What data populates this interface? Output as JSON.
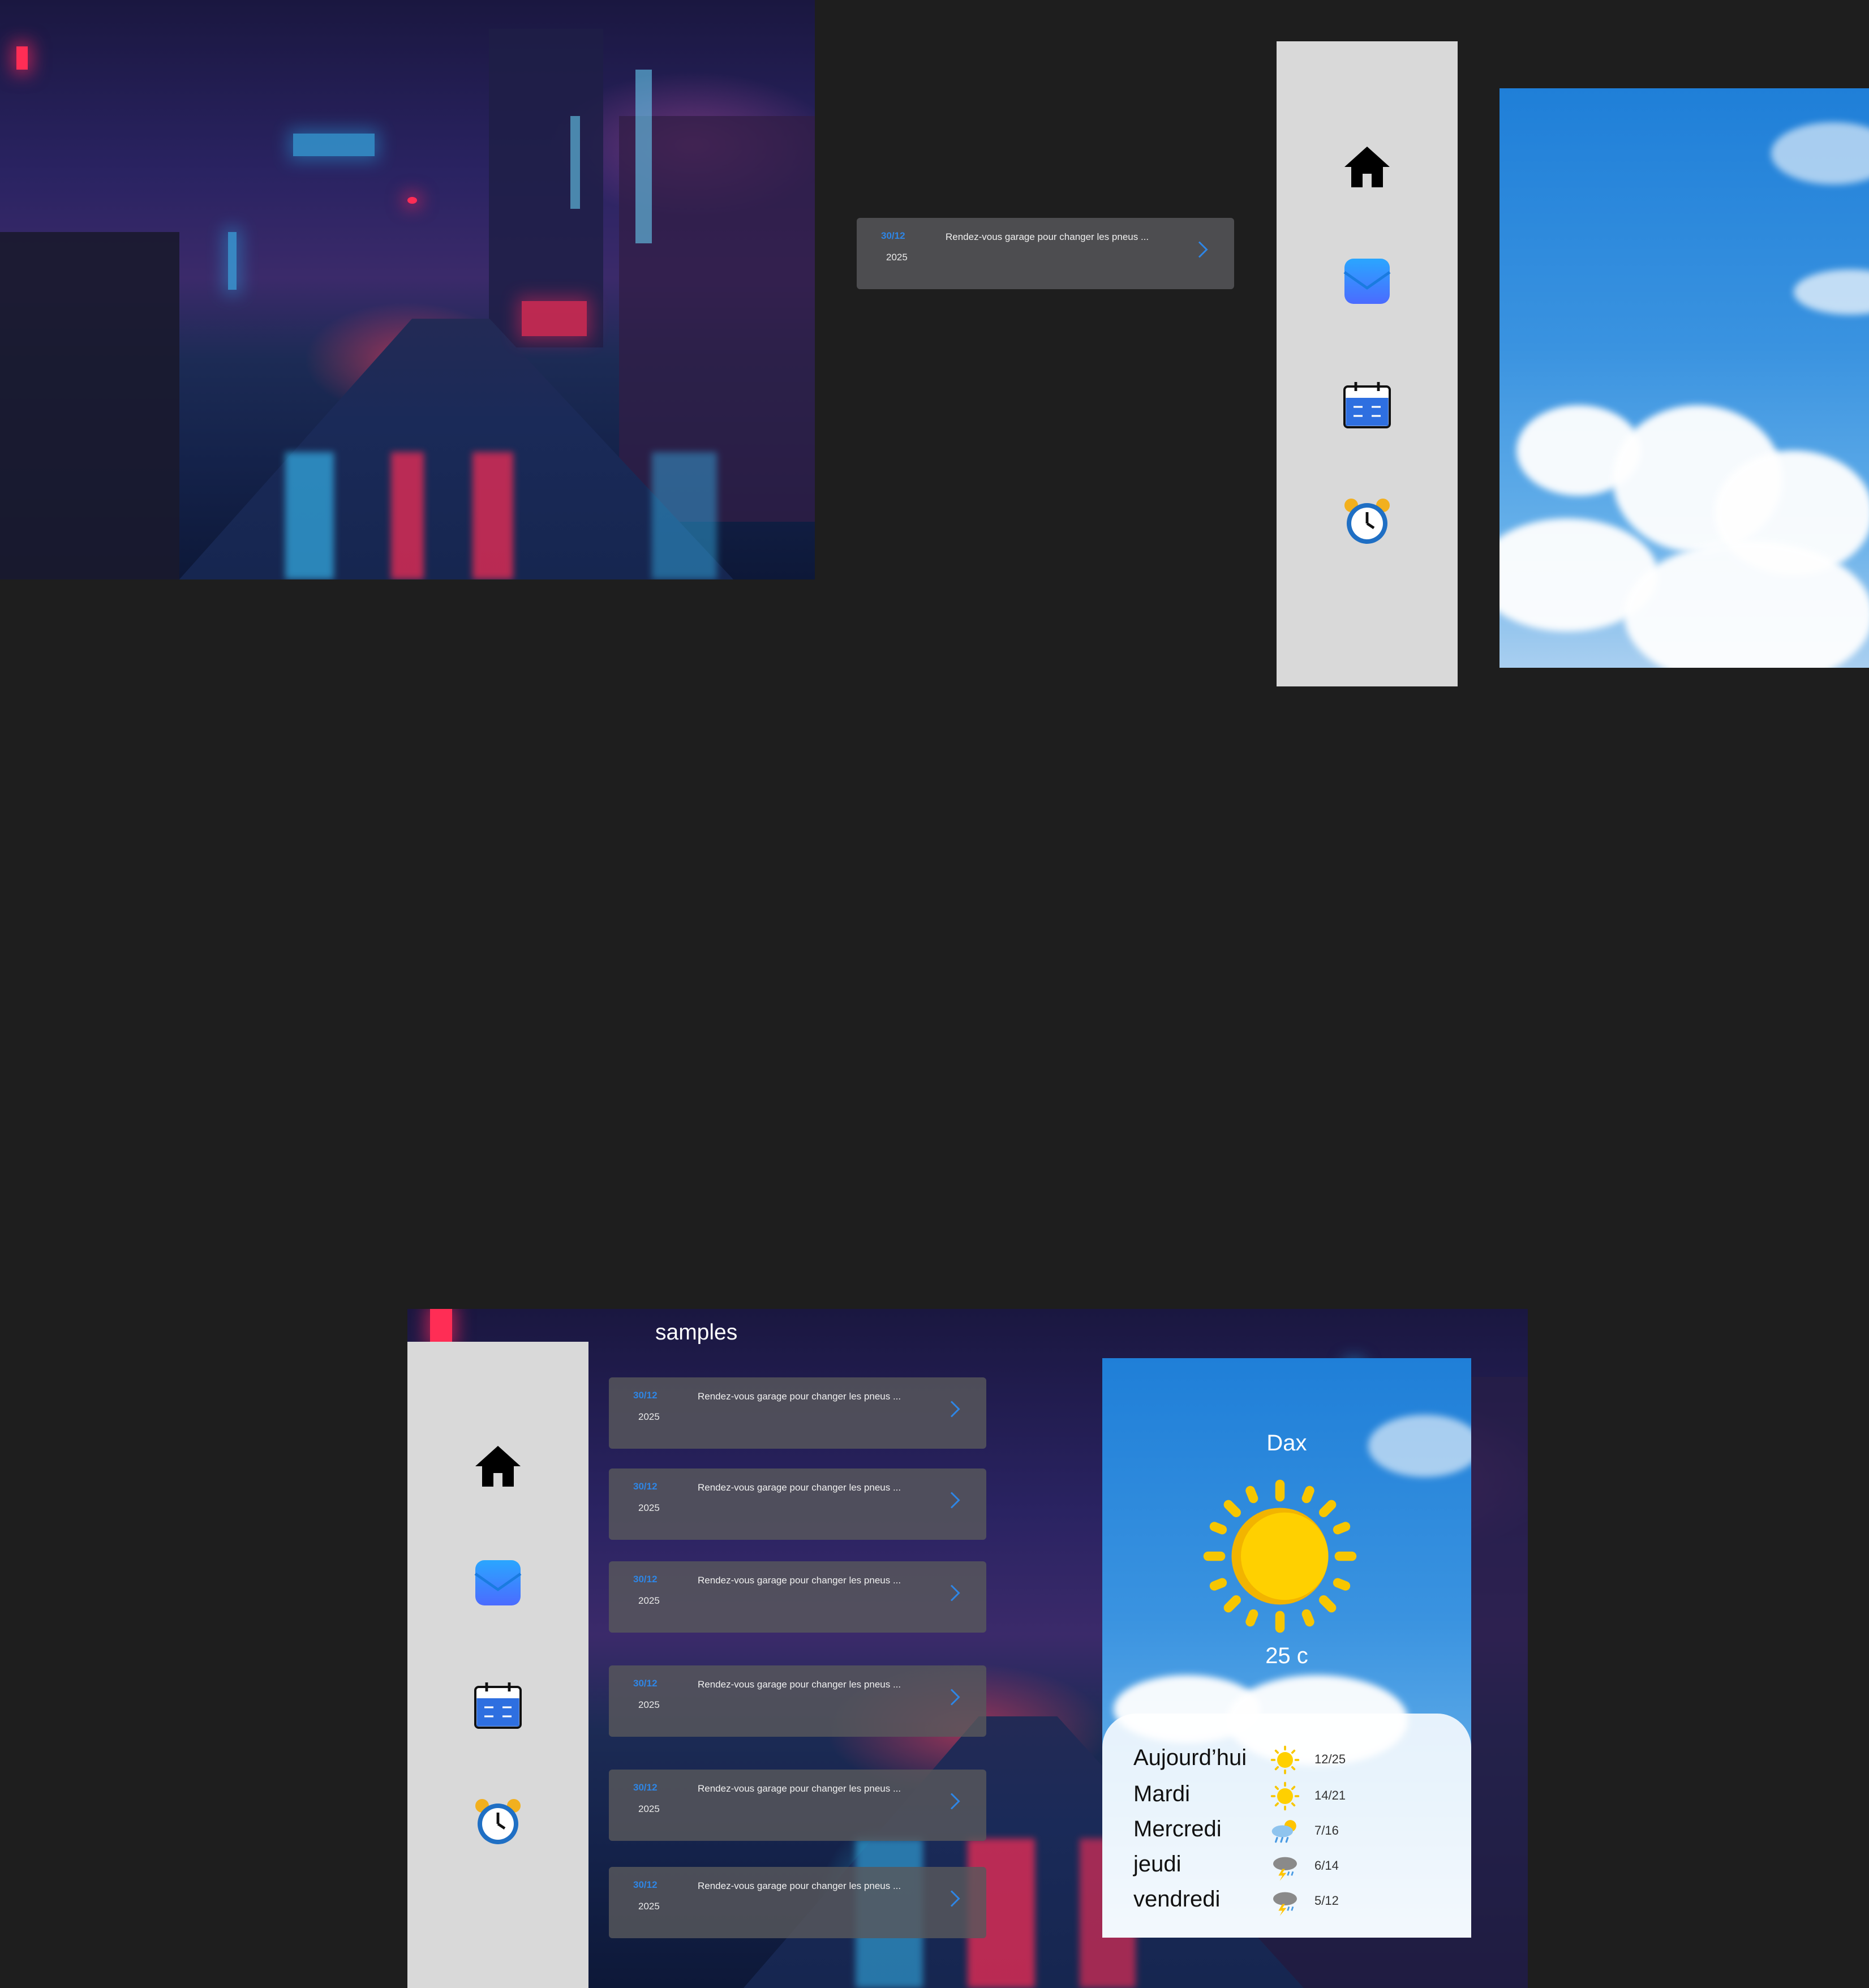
{
  "events": {
    "template_card": {
      "day_month": "30/12",
      "year": "2025",
      "text": "Rendez-vous garage pour changer les pneus ..."
    },
    "list": [
      {
        "day_month": "30/12",
        "year": "2025",
        "text": "Rendez-vous garage pour changer les pneus ..."
      },
      {
        "day_month": "30/12",
        "year": "2025",
        "text": "Rendez-vous garage pour changer les pneus ..."
      },
      {
        "day_month": "30/12",
        "year": "2025",
        "text": "Rendez-vous garage pour changer les pneus ..."
      },
      {
        "day_month": "30/12",
        "year": "2025",
        "text": "Rendez-vous garage pour changer les pneus ..."
      },
      {
        "day_month": "30/12",
        "year": "2025",
        "text": "Rendez-vous garage pour changer les pneus ..."
      },
      {
        "day_month": "30/12",
        "year": "2025",
        "text": "Rendez-vous garage pour changer les pneus ..."
      }
    ]
  },
  "sidebar": {
    "icons": [
      "home-icon",
      "mail-icon",
      "calendar-icon",
      "alarm-clock-icon"
    ]
  },
  "app": {
    "title": "samples"
  },
  "weather": {
    "city": "Dax",
    "temperature": "25 c",
    "forecast": [
      {
        "day": "Aujourd’hui",
        "icon": "sun-icon",
        "range": "12/25"
      },
      {
        "day": "Mardi",
        "icon": "sun-icon",
        "range": "14/21"
      },
      {
        "day": "Mercredi",
        "icon": "rain-sun-icon",
        "range": "7/16"
      },
      {
        "day": "jeudi",
        "icon": "storm-icon",
        "range": "6/14"
      },
      {
        "day": "vendredi",
        "icon": "storm-icon",
        "range": "5/12"
      }
    ]
  },
  "colors": {
    "background": "#1e1e1e",
    "sidebar": "#d9d9d9",
    "accent": "#2e86e6",
    "card": "#58585c"
  }
}
